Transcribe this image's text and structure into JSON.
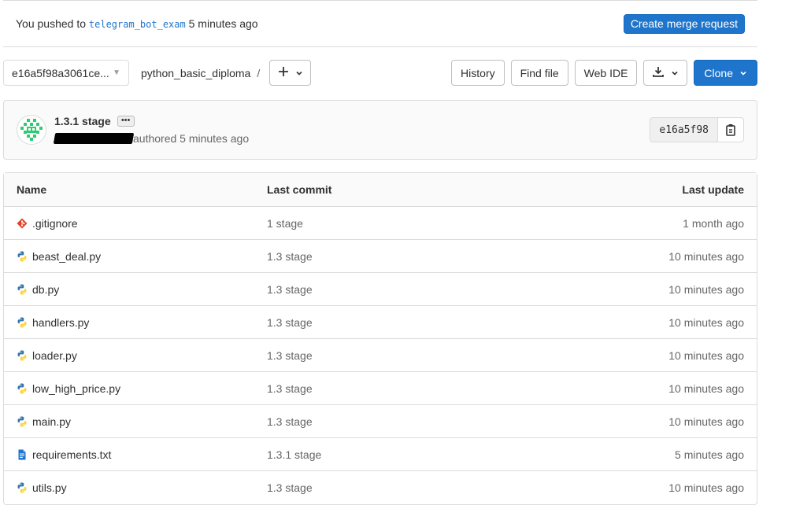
{
  "banner": {
    "prefix": "You pushed to",
    "branch": "telegram_bot_exam",
    "suffix": "5 minutes ago",
    "merge_request_label": "Create merge request"
  },
  "toolbar": {
    "ref": "e16a5f98a3061ce...",
    "breadcrumb_repo": "python_basic_diploma",
    "breadcrumb_sep": "/",
    "history_label": "History",
    "find_file_label": "Find file",
    "web_ide_label": "Web IDE",
    "clone_label": "Clone"
  },
  "commit": {
    "title": "1.3.1 stage",
    "ellipsis": "•••",
    "authored": "authored 5 minutes ago",
    "sha": "e16a5f98"
  },
  "table": {
    "headers": {
      "name": "Name",
      "last_commit": "Last commit",
      "last_update": "Last update"
    },
    "rows": [
      {
        "name": ".gitignore",
        "icon": "git-icon",
        "commit": "1 stage",
        "updated": "1 month ago"
      },
      {
        "name": "beast_deal.py",
        "icon": "python-icon",
        "commit": "1.3 stage",
        "updated": "10 minutes ago"
      },
      {
        "name": "db.py",
        "icon": "python-icon",
        "commit": "1.3 stage",
        "updated": "10 minutes ago"
      },
      {
        "name": "handlers.py",
        "icon": "python-icon",
        "commit": "1.3 stage",
        "updated": "10 minutes ago"
      },
      {
        "name": "loader.py",
        "icon": "python-icon",
        "commit": "1.3 stage",
        "updated": "10 minutes ago"
      },
      {
        "name": "low_high_price.py",
        "icon": "python-icon",
        "commit": "1.3 stage",
        "updated": "10 minutes ago"
      },
      {
        "name": "main.py",
        "icon": "python-icon",
        "commit": "1.3 stage",
        "updated": "10 minutes ago"
      },
      {
        "name": "requirements.txt",
        "icon": "text-file-icon",
        "commit": "1.3.1 stage",
        "updated": "5 minutes ago"
      },
      {
        "name": "utils.py",
        "icon": "python-icon",
        "commit": "1.3 stage",
        "updated": "10 minutes ago"
      }
    ]
  },
  "colors": {
    "accent": "#1f75cb",
    "border": "#dbdbdb",
    "python_blue": "#3776ab",
    "python_yellow": "#ffd43b",
    "git_orange": "#e24329"
  }
}
